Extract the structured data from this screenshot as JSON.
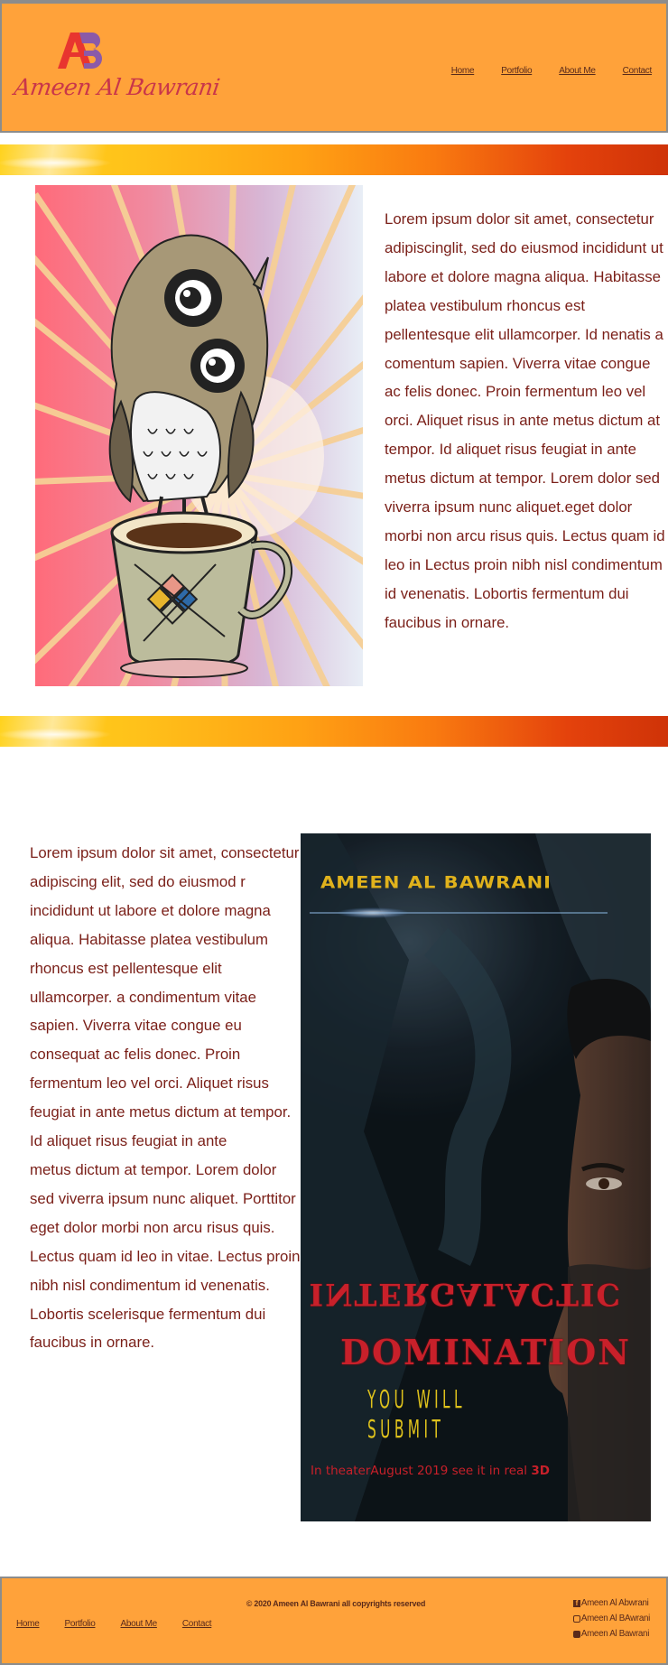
{
  "header": {
    "logo_mark": "AB",
    "logo_text": "Ameen Al Bawrani",
    "nav": [
      "Home",
      "Portfolio",
      "About Me",
      "Contact"
    ]
  },
  "section1": {
    "paragraph": "Lorem ipsum dolor sit amet, consectetur adipiscinglit, sed do eiusmod incididunt ut labore et dolore magna aliqua. Habitasse platea vestibulum rhoncus est pellentesque elit ullamcorper. Id nenatis a comentum sapien. Viverra vitae congue ac felis donec. Proin fermentum leo vel orci. Aliquet risus  in ante metus dictum at tempor. Id aliquet risus feugiat in ante\nmetus dictum at tempor. Lorem dolor sed viverra ipsum nunc aliquet.eget dolor morbi non arcu risus quis. Lectus quam id leo in  Lectus proin nibh nisl condimentum id venenatis. Lobortis fermentum dui faucibus in ornare."
  },
  "section2": {
    "paragraph": "Lorem ipsum dolor sit amet, consectetur adipiscing elit, sed do eiusmod r incididunt ut labore et dolore magna aliqua. Habitasse platea vestibulum rhoncus est pellentesque elit ullamcorper.  a condimentum vitae sapien. Viverra vitae congue eu\nconsequat ac felis donec. Proin fermentum leo vel orci. Aliquet risus feugiat in ante metus dictum at tempor. Id aliquet risus feugiat in ante\nmetus dictum at tempor. Lorem dolor sed viverra ipsum nunc aliquet. Porttitor eget dolor morbi non arcu risus quis. Lectus quam id leo in vitae. Lectus proin nibh nisl condimentum id venenatis. Lobortis scelerisque fermentum dui faucibus in ornare.",
    "poster": {
      "top_title": "AMEEN AL BAWRANI",
      "title_line1": "INTERGALACTIC",
      "title_line2": "DOMINATION",
      "tagline": "YOU WILL SUBMIT",
      "release_text": "In theaterAugust 2019 see it in real ",
      "release_3d": "3D"
    }
  },
  "footer": {
    "copyright": "© 2020 Ameen Al Bawrani all copyrights reserved",
    "nav": [
      "Home",
      "Portfolio",
      "About Me",
      "Contact"
    ],
    "social": [
      {
        "icon": "facebook-icon",
        "label": "Ameen Al Abwrani"
      },
      {
        "icon": "instagram-icon",
        "label": "Ameen Al BAwrani"
      },
      {
        "icon": "youtube-icon",
        "label": "Ameen Al Bawrani"
      }
    ]
  },
  "colors": {
    "header_bg": "#ffa23a",
    "body_text": "#7a1f18",
    "logo": "#c9364a"
  }
}
